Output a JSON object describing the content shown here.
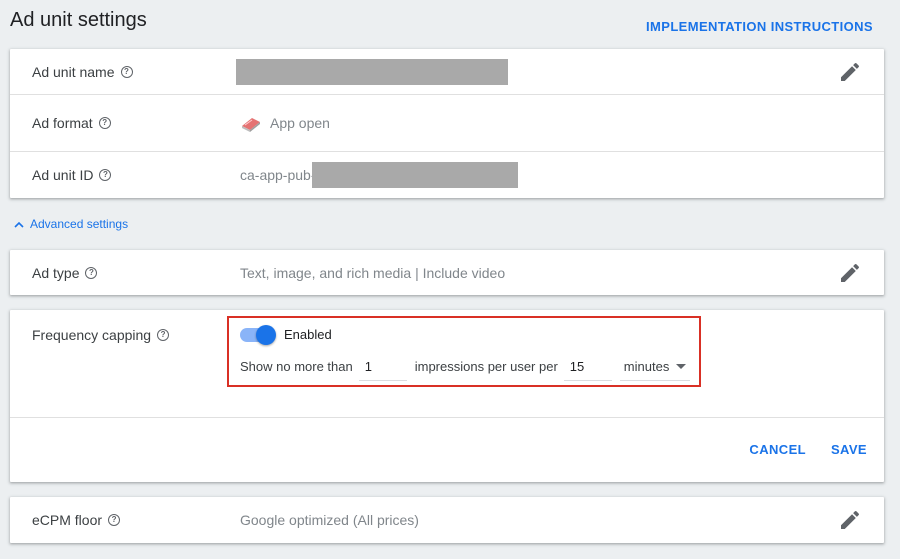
{
  "header": {
    "title": "Ad unit settings",
    "implementation_link": "IMPLEMENTATION INSTRUCTIONS"
  },
  "info_card": {
    "ad_unit_name": {
      "label": "Ad unit name"
    },
    "ad_format": {
      "label": "Ad format",
      "value": "App open",
      "icon": "app-open-book-icon"
    },
    "ad_unit_id": {
      "label": "Ad unit ID",
      "value_prefix": "ca-app-pub-"
    }
  },
  "advanced_toggle": {
    "label": "Advanced settings"
  },
  "ad_type": {
    "label": "Ad type",
    "value": "Text, image, and rich media | Include video"
  },
  "frequency_capping": {
    "label": "Frequency capping",
    "toggle_label": "Enabled",
    "enabled": true,
    "prefix_text": "Show no more than",
    "impressions": "1",
    "middle_text": "impressions per user per",
    "period": "15",
    "unit": "minutes",
    "cancel": "CANCEL",
    "save": "SAVE"
  },
  "ecpm_floor": {
    "label": "eCPM floor",
    "value": "Google optimized (All prices)"
  },
  "colors": {
    "accent": "#1a73e8",
    "highlight_border": "#d93025",
    "background": "#eceff1"
  }
}
